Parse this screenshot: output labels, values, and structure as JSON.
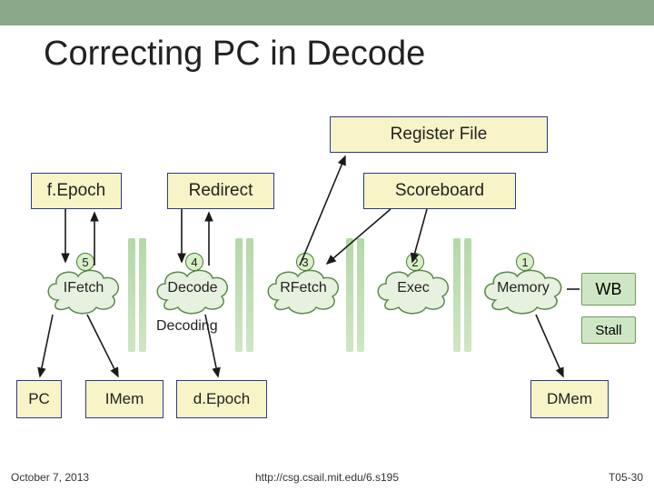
{
  "title": "Correcting PC in Decode",
  "boxes": {
    "register_file": "Register File",
    "fepoch": "f.Epoch",
    "redirect": "Redirect",
    "scoreboard": "Scoreboard",
    "pc": "PC",
    "imem": "IMem",
    "depoch": "d.Epoch",
    "dmem": "DMem"
  },
  "stages": [
    {
      "num": "5",
      "label": "IFetch"
    },
    {
      "num": "4",
      "label": "Decode"
    },
    {
      "num": "3",
      "label": "RFetch"
    },
    {
      "num": "2",
      "label": "Exec"
    },
    {
      "num": "1",
      "label": "Memory"
    }
  ],
  "labels": {
    "wb": "WB",
    "stall": "Stall",
    "decoding": "Decoding"
  },
  "footer": {
    "date": "October 7, 2013",
    "url": "http://csg.csail.mit.edu/6.s195",
    "slide": "T05-30"
  }
}
